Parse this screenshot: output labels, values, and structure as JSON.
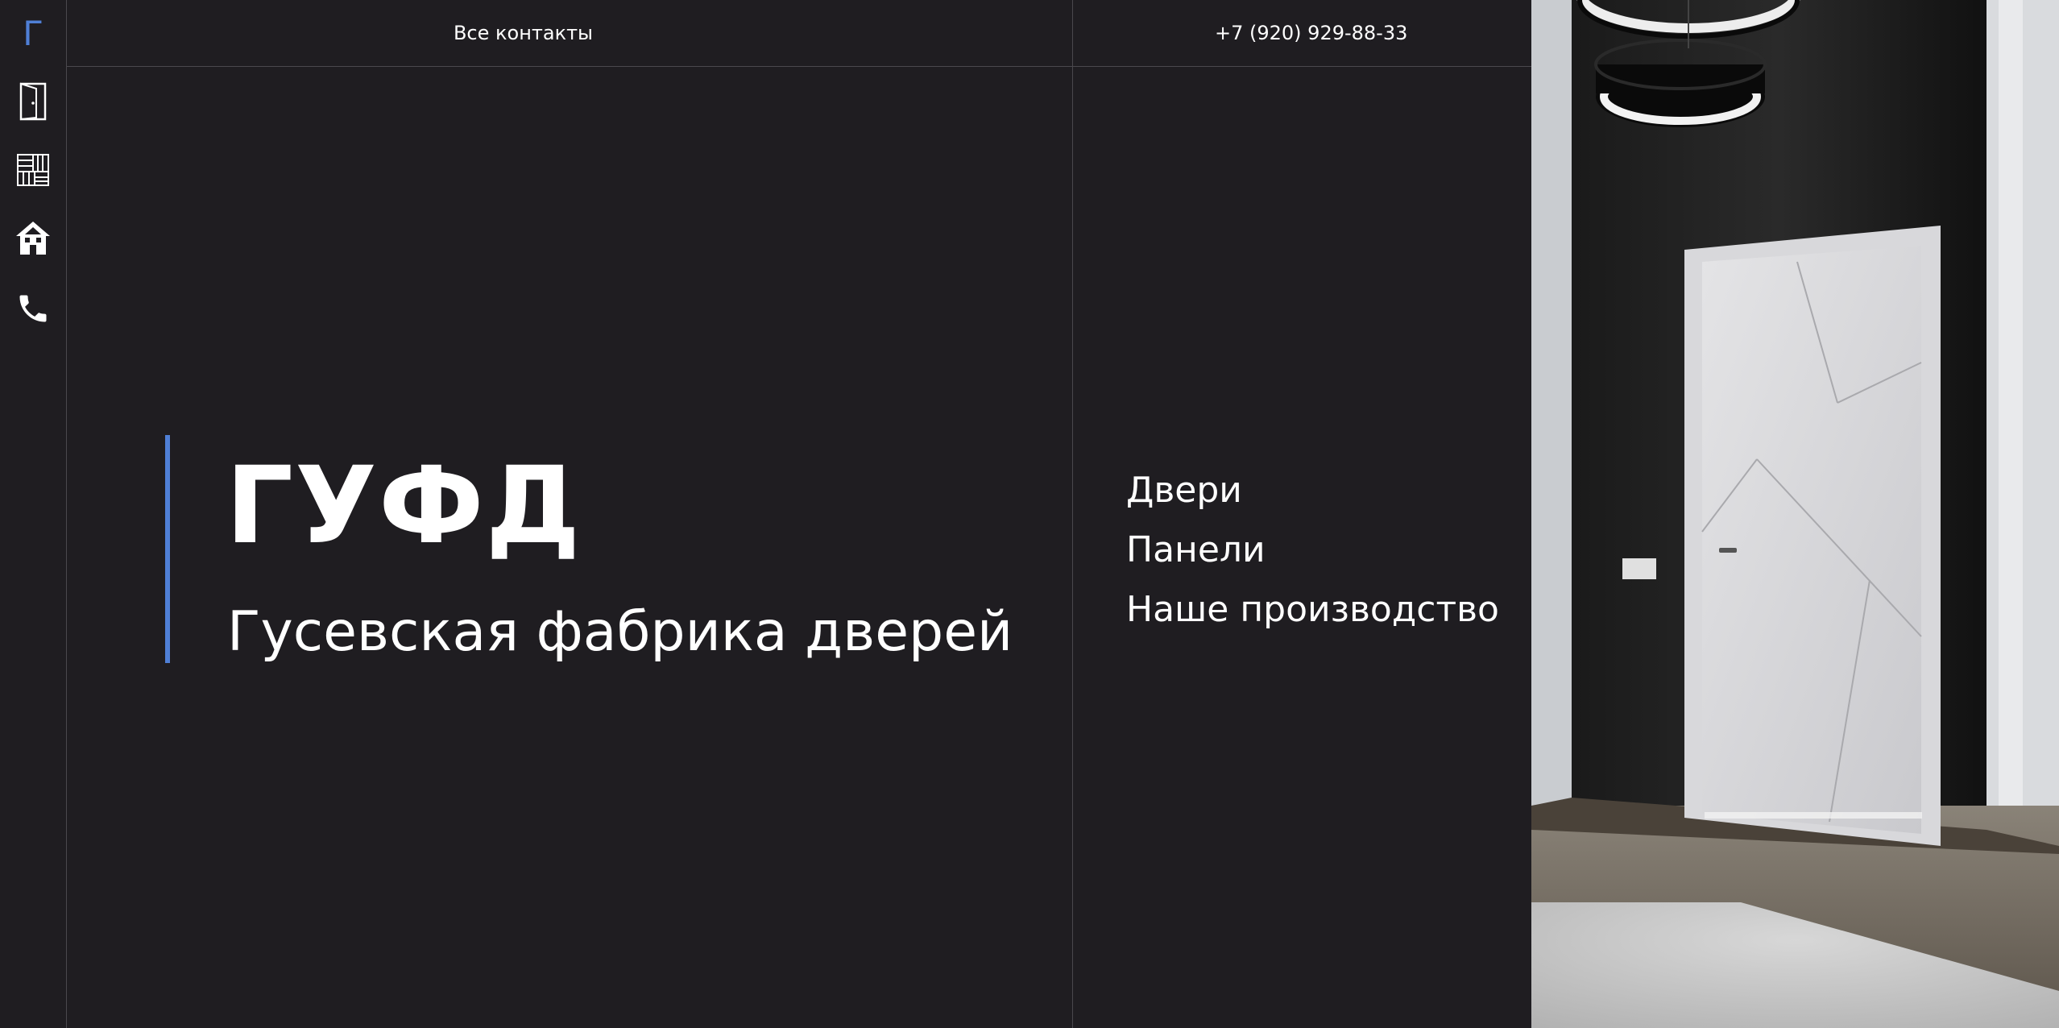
{
  "sidebar": {
    "logo": "Г",
    "icons": [
      {
        "name": "door-icon"
      },
      {
        "name": "panels-icon"
      },
      {
        "name": "house-icon"
      },
      {
        "name": "phone-icon"
      }
    ]
  },
  "header": {
    "contacts_label": "Все контакты",
    "phone": "+7 (920) 929-88-33"
  },
  "hero": {
    "title": "ГУФД",
    "subtitle": "Гусевская фабрика дверей"
  },
  "menu": {
    "items": [
      {
        "label": "Двери"
      },
      {
        "label": "Панели"
      },
      {
        "label": "Наше производство"
      }
    ]
  },
  "colors": {
    "background": "#1f1d21",
    "accent": "#4f7fd6",
    "divider": "#4a484d"
  }
}
